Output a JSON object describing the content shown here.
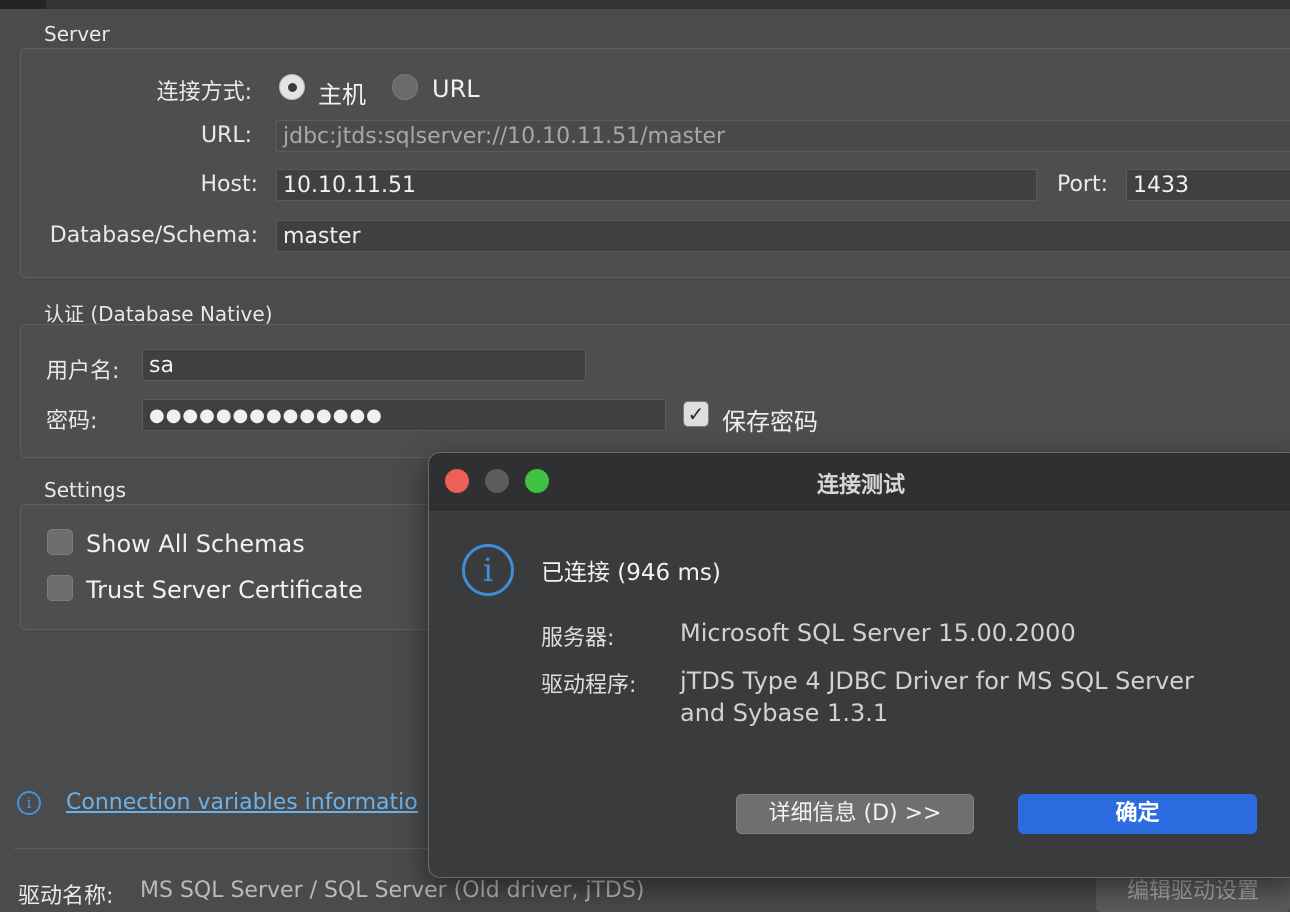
{
  "server": {
    "section_title": "Server",
    "connect_mode_label": "连接方式:",
    "mode_host": "主机",
    "mode_url": "URL",
    "url_label": "URL:",
    "url_value": "jdbc:jtds:sqlserver://10.10.11.51/master",
    "host_label": "Host:",
    "host_value": "10.10.11.51",
    "port_label": "Port:",
    "port_value": "1433",
    "db_label": "Database/Schema:",
    "db_value": "master"
  },
  "auth": {
    "section_title": "认证 (Database Native)",
    "user_label": "用户名:",
    "user_value": "sa",
    "password_label": "密码:",
    "password_value": "●●●●●●●●●●●●●●",
    "save_password_label": "保存密码"
  },
  "settings": {
    "section_title": "Settings",
    "show_all_schemas": "Show All Schemas",
    "trust_cert": "Trust Server Certificate"
  },
  "footer": {
    "info_link": "Connection variables informatio",
    "driver_label": "驱动名称:",
    "driver_value": "MS SQL Server / SQL Server (Old driver, jTDS)",
    "edit_driver": "编辑驱动设置"
  },
  "dialog": {
    "title": "连接测试",
    "status": "已连接 (946 ms)",
    "server_label": "服务器:",
    "server_value": "Microsoft SQL Server 15.00.2000",
    "driver_label": "驱动程序:",
    "driver_value": "jTDS Type 4 JDBC Driver for MS SQL Server and Sybase 1.3.1",
    "details_button": "详细信息 (D) >>",
    "ok_button": "确定"
  }
}
